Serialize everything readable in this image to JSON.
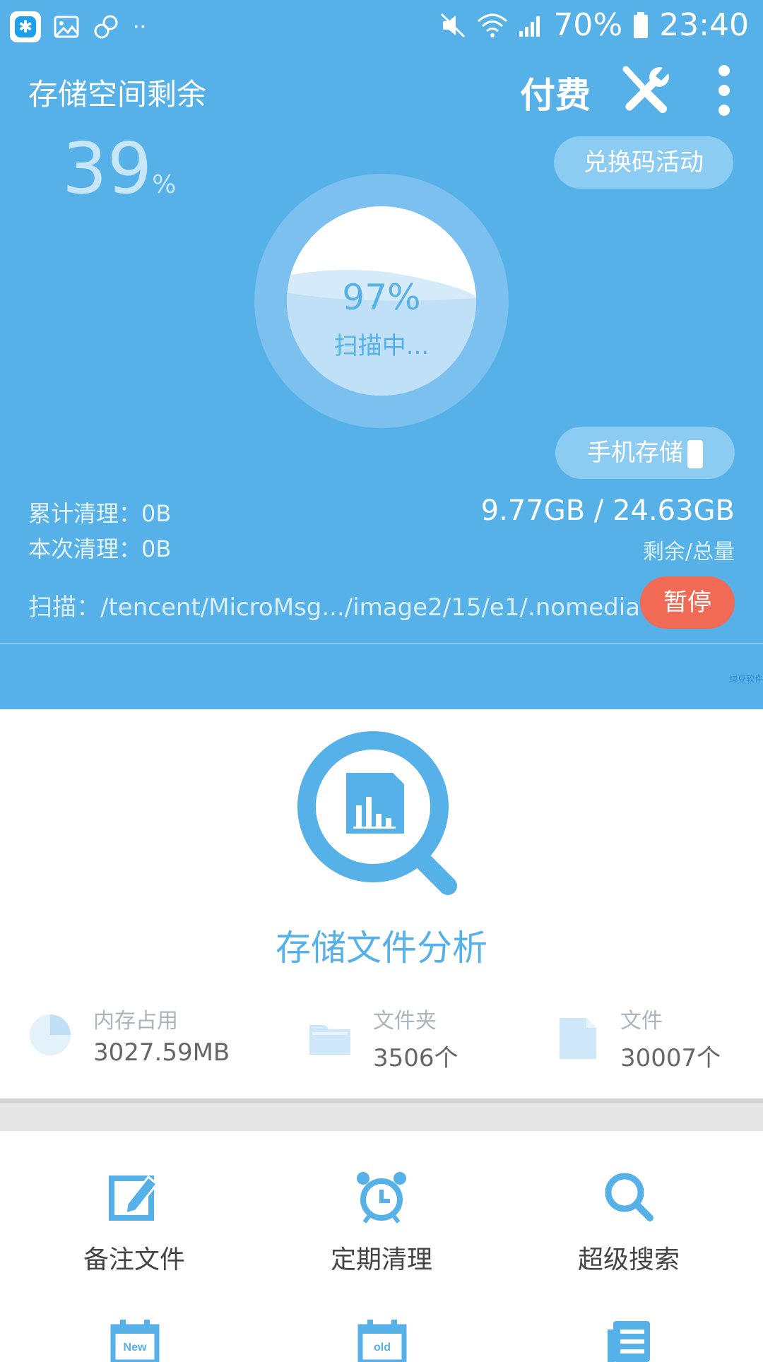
{
  "status_bar": {
    "battery": "70%",
    "time": "23:40"
  },
  "header": {
    "title": "存储空间剩余",
    "pay_label": "付费",
    "redeem_label": "兑换码活动"
  },
  "storage": {
    "remaining_percent": "39",
    "percent_sign": "%",
    "scan_progress": "97%",
    "scan_status": "扫描中...",
    "phone_storage_label": "手机存储",
    "total_cleaned": "累计清理：0B",
    "this_cleaned": "本次清理：0B",
    "size_value": "9.77GB / 24.63GB",
    "size_label": "剩余/总量",
    "scan_path": "扫描：/tencent/MicroMsg.../image2/15/e1/.nomedia",
    "pause_label": "暂停",
    "watermark": "绿豆软件"
  },
  "analysis": {
    "title": "存储文件分析",
    "items": [
      {
        "label": "内存占用",
        "value": "3027.59MB"
      },
      {
        "label": "文件夹",
        "value": "3506个"
      },
      {
        "label": "文件",
        "value": "30007个"
      }
    ]
  },
  "tools": [
    {
      "label": "备注文件",
      "icon": "edit-icon"
    },
    {
      "label": "定期清理",
      "icon": "alarm-clock-icon"
    },
    {
      "label": "超级搜索",
      "icon": "search-icon"
    }
  ],
  "bottom_icons": [
    "calendar-new-icon",
    "calendar-old-icon",
    "document-list-icon"
  ],
  "colors": {
    "primary": "#55b1e8",
    "pause": "#f06a56"
  }
}
